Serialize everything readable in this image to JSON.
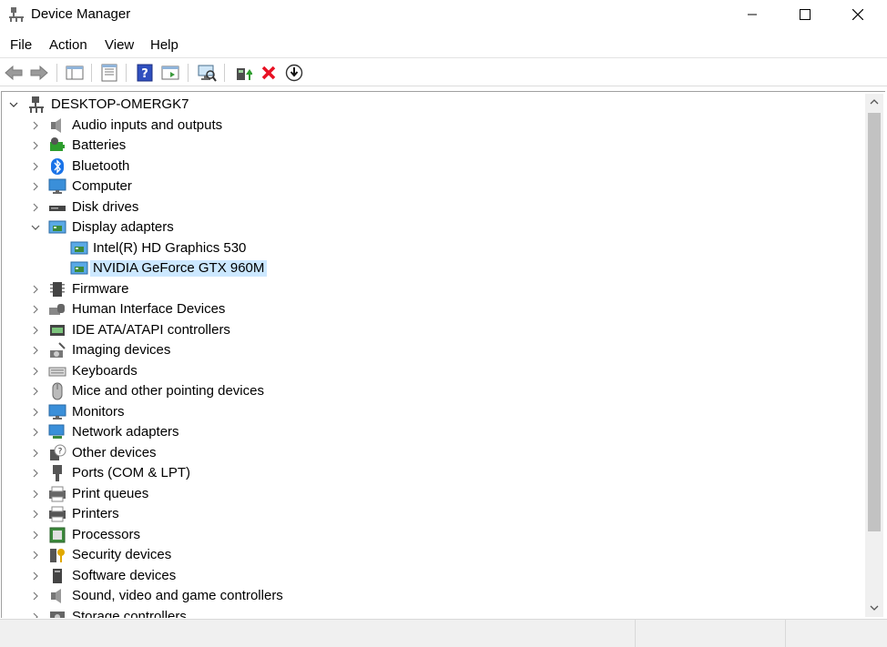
{
  "window": {
    "title": "Device Manager"
  },
  "menu": [
    "File",
    "Action",
    "View",
    "Help"
  ],
  "tree": {
    "root": "DESKTOP-OMERGK7",
    "categories": [
      {
        "label": "Audio inputs and outputs",
        "icon": "speaker-icon"
      },
      {
        "label": "Batteries",
        "icon": "battery-icon"
      },
      {
        "label": "Bluetooth",
        "icon": "bluetooth-icon"
      },
      {
        "label": "Computer",
        "icon": "computer-icon"
      },
      {
        "label": "Disk drives",
        "icon": "disk-drive-icon"
      },
      {
        "label": "Display adapters",
        "icon": "display-adapter-icon",
        "expanded": true,
        "children": [
          {
            "label": "Intel(R) HD Graphics 530",
            "icon": "display-adapter-icon"
          },
          {
            "label": "NVIDIA GeForce GTX 960M",
            "icon": "display-adapter-icon",
            "selected": true
          }
        ]
      },
      {
        "label": "Firmware",
        "icon": "firmware-icon"
      },
      {
        "label": "Human Interface Devices",
        "icon": "hid-icon"
      },
      {
        "label": "IDE ATA/ATAPI controllers",
        "icon": "ide-controller-icon"
      },
      {
        "label": "Imaging devices",
        "icon": "camera-icon"
      },
      {
        "label": "Keyboards",
        "icon": "keyboard-icon"
      },
      {
        "label": "Mice and other pointing devices",
        "icon": "mouse-icon"
      },
      {
        "label": "Monitors",
        "icon": "monitor-icon"
      },
      {
        "label": "Network adapters",
        "icon": "network-adapter-icon"
      },
      {
        "label": "Other devices",
        "icon": "unknown-device-icon"
      },
      {
        "label": "Ports (COM & LPT)",
        "icon": "port-icon"
      },
      {
        "label": "Print queues",
        "icon": "print-queue-icon"
      },
      {
        "label": "Printers",
        "icon": "printer-icon"
      },
      {
        "label": "Processors",
        "icon": "processor-icon"
      },
      {
        "label": "Security devices",
        "icon": "security-device-icon"
      },
      {
        "label": "Software devices",
        "icon": "software-device-icon"
      },
      {
        "label": "Sound, video and game controllers",
        "icon": "sound-icon"
      },
      {
        "label": "Storage controllers",
        "icon": "storage-controller-icon"
      }
    ]
  },
  "colors": {
    "selection": "#cce8ff",
    "accent": "#0078d7",
    "remove": "#e81123"
  }
}
